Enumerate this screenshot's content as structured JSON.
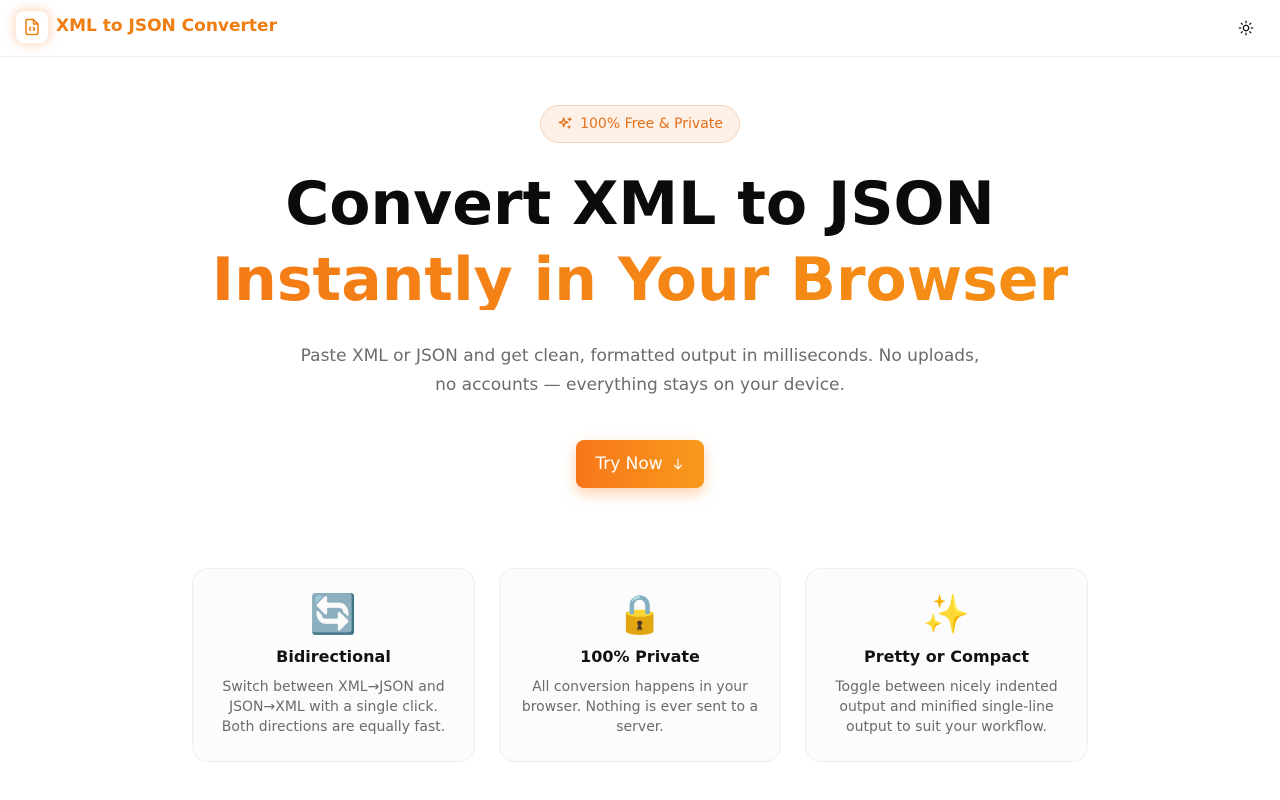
{
  "header": {
    "brand": "XML to JSON Converter",
    "logo_icon": "file-code-icon",
    "theme_icon": "sun-icon"
  },
  "hero": {
    "badge": "100% Free & Private",
    "badge_icon": "sparkles-icon",
    "title_line1": "Convert XML to JSON",
    "title_line2": "Instantly in Your Browser",
    "subtitle": "Paste XML or JSON and get clean, formatted output in milliseconds. No uploads, no accounts — everything stays on your device.",
    "cta_label": "Try Now",
    "cta_icon": "arrow-down-icon"
  },
  "features": [
    {
      "emoji": "🔄",
      "title": "Bidirectional",
      "desc": "Switch between XML→JSON and JSON→XML with a single click. Both directions are equally fast."
    },
    {
      "emoji": "🔒",
      "title": "100% Private",
      "desc": "All conversion happens in your browser. Nothing is ever sent to a server."
    },
    {
      "emoji": "✨",
      "title": "Pretty or Compact",
      "desc": "Toggle between nicely indented output and minified single-line output to suit your workflow."
    }
  ],
  "colors": {
    "accent": "#f47617",
    "accent_light": "#f59414",
    "badge_bg": "#fdf0e7",
    "text_muted": "#6b6b6b"
  }
}
